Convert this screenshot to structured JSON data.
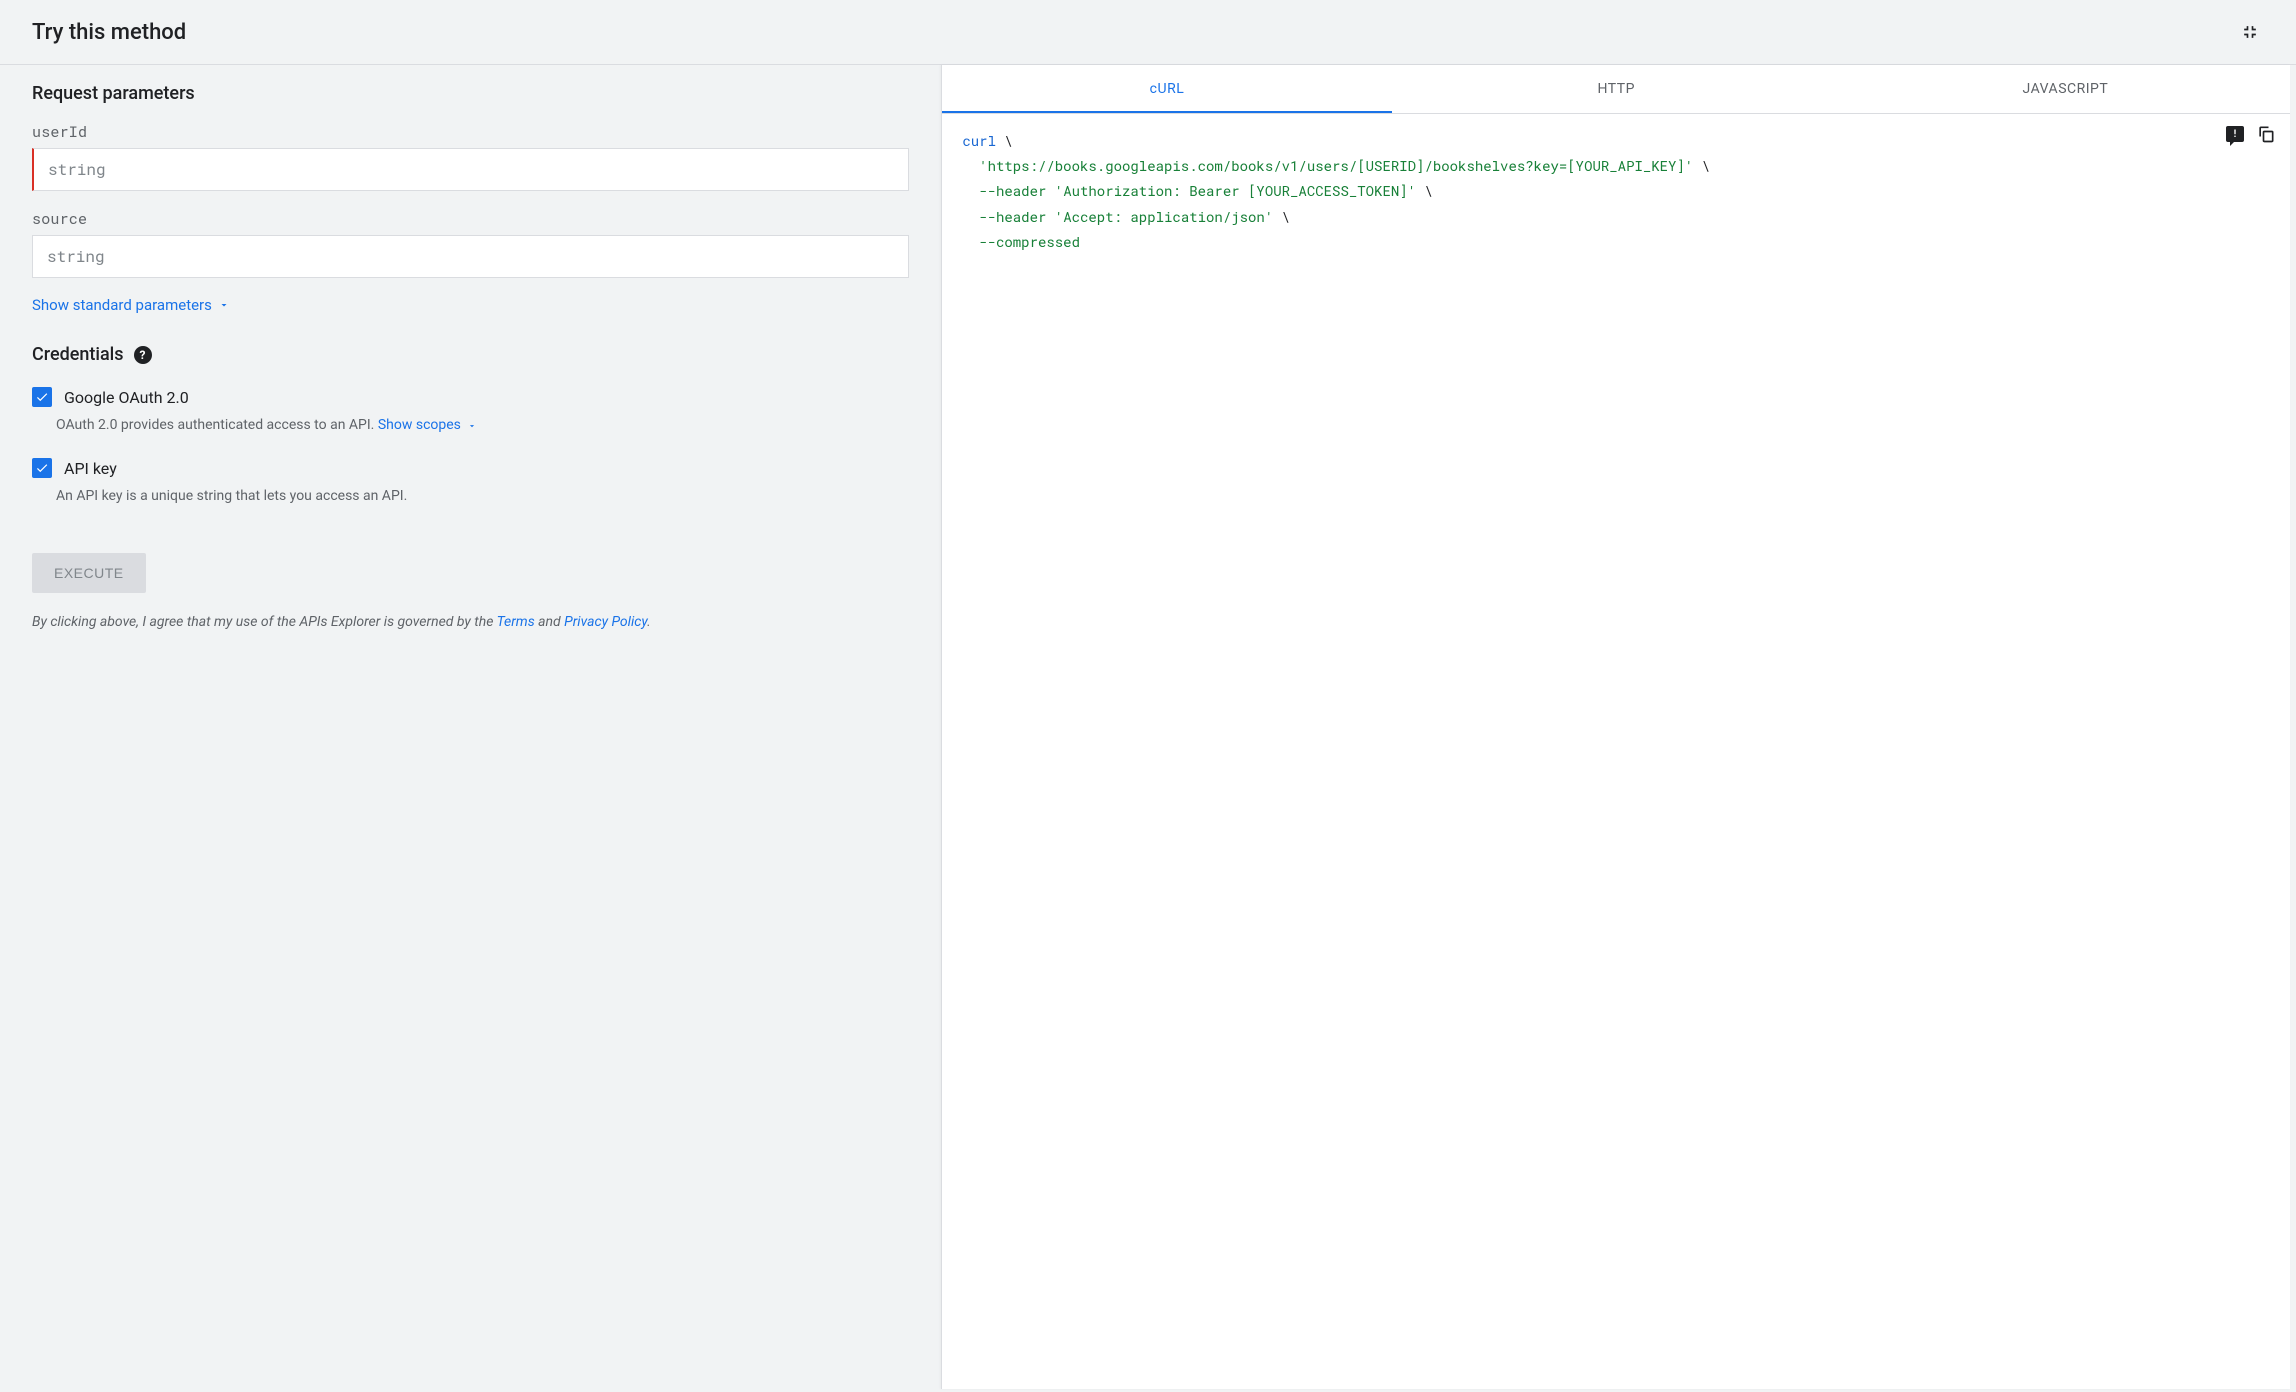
{
  "header": {
    "title": "Try this method"
  },
  "params": {
    "section_title": "Request parameters",
    "fields": [
      {
        "label": "userId",
        "placeholder": "string",
        "required": true
      },
      {
        "label": "source",
        "placeholder": "string",
        "required": false
      }
    ],
    "show_standard": "Show standard parameters"
  },
  "credentials": {
    "title": "Credentials",
    "oauth": {
      "label": "Google OAuth 2.0",
      "desc": "OAuth 2.0 provides authenticated access to an API.",
      "show_scopes": "Show scopes",
      "checked": true
    },
    "apikey": {
      "label": "API key",
      "desc": "An API key is a unique string that lets you access an API.",
      "checked": true
    }
  },
  "execute": {
    "label": "EXECUTE",
    "disclaimer_pre": "By clicking above, I agree that my use of the APIs Explorer is governed by the ",
    "terms": "Terms",
    "and": " and ",
    "privacy": "Privacy Policy",
    "period": "."
  },
  "tabs": {
    "curl": "cURL",
    "http": "HTTP",
    "js": "JAVASCRIPT"
  },
  "code": {
    "l1a": "curl",
    "l1b": " \\",
    "l2a": "  ",
    "l2b": "'https://books.googleapis.com/books/v1/users/[USERID]/bookshelves?key=[YOUR_API_KEY]'",
    "l2c": " \\",
    "l3a": "  ",
    "l3b": "--header",
    "l3c": " ",
    "l3d": "'Authorization: Bearer [YOUR_ACCESS_TOKEN]'",
    "l3e": " \\",
    "l4a": "  ",
    "l4b": "--header",
    "l4c": " ",
    "l4d": "'Accept: application/json'",
    "l4e": " \\",
    "l5a": "  ",
    "l5b": "--compressed"
  }
}
